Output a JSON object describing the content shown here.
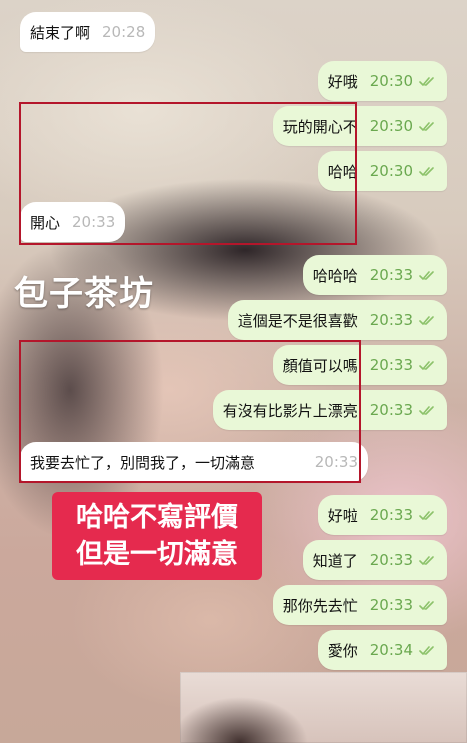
{
  "colors": {
    "outgoing_bubble": "#e9f8d7",
    "incoming_bubble": "#ffffff",
    "outgoing_time": "#6aa84f",
    "incoming_time": "#b8b8b8",
    "highlight": "#b4162b",
    "promo_bg": "#e52a4e"
  },
  "messages": [
    {
      "text": "結束了啊",
      "time": "20:28",
      "direction": "in",
      "read": false
    },
    {
      "text": "好哦",
      "time": "20:30",
      "direction": "out",
      "read": true
    },
    {
      "text": "玩的開心不",
      "time": "20:30",
      "direction": "out",
      "read": true
    },
    {
      "text": "哈哈",
      "time": "20:30",
      "direction": "out",
      "read": true
    },
    {
      "text": "開心",
      "time": "20:33",
      "direction": "in",
      "read": false
    },
    {
      "text": "哈哈哈",
      "time": "20:33",
      "direction": "out",
      "read": true
    },
    {
      "text": "這個是不是很喜歡",
      "time": "20:33",
      "direction": "out",
      "read": true
    },
    {
      "text": "顏值可以嗎",
      "time": "20:33",
      "direction": "out",
      "read": true
    },
    {
      "text": "有沒有比影片上漂亮",
      "time": "20:33",
      "direction": "out",
      "read": true
    },
    {
      "text": "我要去忙了，別問我了，一切滿意",
      "time": "20:33",
      "direction": "in",
      "read": false
    },
    {
      "text": "好啦",
      "time": "20:33",
      "direction": "out",
      "read": true
    },
    {
      "text": "知道了",
      "time": "20:33",
      "direction": "out",
      "read": true
    },
    {
      "text": "那你先去忙",
      "time": "20:33",
      "direction": "out",
      "read": true
    },
    {
      "text": "愛你",
      "time": "20:34",
      "direction": "out",
      "read": true
    }
  ],
  "overlay": {
    "watermark": "包子茶坊",
    "promo_line1": "哈哈不寫評價",
    "promo_line2": "但是一切滿意"
  }
}
